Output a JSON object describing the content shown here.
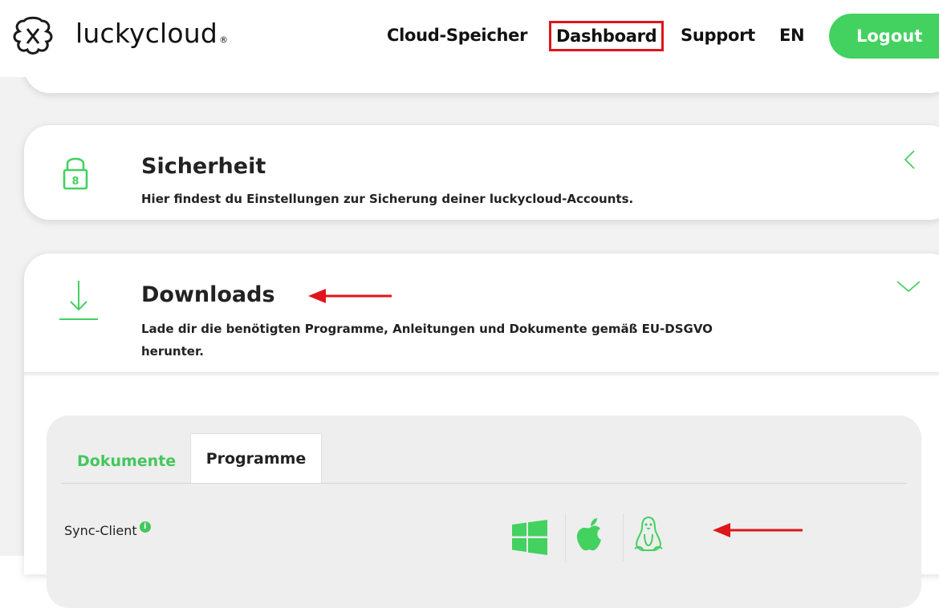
{
  "brand": {
    "name": "luckycloud",
    "registered": "®"
  },
  "nav": {
    "cloud": "Cloud-Speicher",
    "dashboard": "Dashboard",
    "support": "Support",
    "lang": "EN",
    "logout": "Logout"
  },
  "sections": {
    "security": {
      "title": "Sicherheit",
      "desc": "Hier findest du Einstellungen zur Sicherung deiner luckycloud-Accounts.",
      "icon": "lock-icon"
    },
    "downloads": {
      "title": "Downloads",
      "desc_line1": "Lade dir die benötigten Programme, Anleitungen und Dokumente gemäß EU-DSGVO",
      "desc_line2": "herunter.",
      "icon": "download-icon"
    }
  },
  "tabs": {
    "documents": "Dokumente",
    "programs": "Programme"
  },
  "programs": {
    "sync_client_label": "Sync-Client",
    "info_badge": "i",
    "platforms": [
      "windows-icon",
      "apple-icon",
      "linux-icon"
    ]
  },
  "colors": {
    "accent": "#43d160",
    "highlight": "#e0141b"
  }
}
